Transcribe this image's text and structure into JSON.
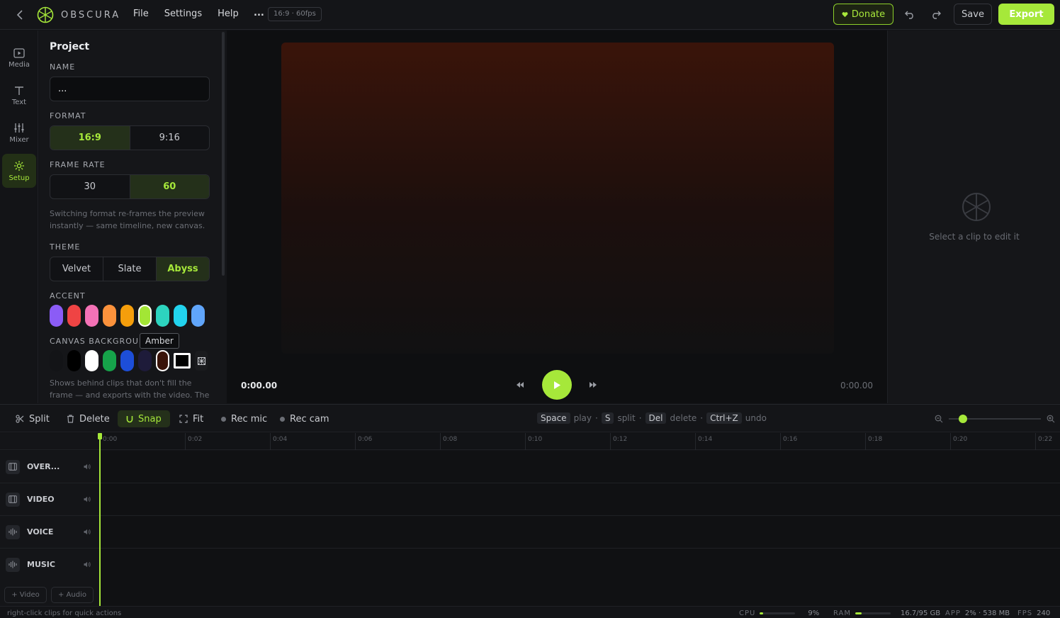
{
  "topbar": {
    "brand": "OBSCURA",
    "menu": [
      "File",
      "Settings",
      "Help"
    ],
    "project_dots": "...",
    "format_chip": "16:9 · 60fps",
    "donate_label": "Donate",
    "save_label": "Save",
    "export_label": "Export"
  },
  "rail": {
    "items": [
      {
        "label": "Media",
        "icon": "media-icon",
        "active": false
      },
      {
        "label": "Text",
        "icon": "text-icon",
        "active": false
      },
      {
        "label": "Mixer",
        "icon": "mixer-icon",
        "active": false
      },
      {
        "label": "Setup",
        "icon": "gear-icon",
        "active": true
      }
    ]
  },
  "panel": {
    "title": "Project",
    "name_label": "NAME",
    "name_value": "...",
    "format_label": "FORMAT",
    "format_options": [
      "16:9",
      "9:16"
    ],
    "format_selected": "16:9",
    "framerate_label": "FRAME RATE",
    "framerate_options": [
      "30",
      "60"
    ],
    "framerate_selected": "60",
    "format_hint": "Switching format re-frames the preview instantly — same timeline, new canvas.",
    "theme_label": "THEME",
    "theme_options": [
      "Velvet",
      "Slate",
      "Abyss"
    ],
    "theme_selected": "Abyss",
    "accent_label": "ACCENT",
    "accent_colors": [
      "#8b5cf6",
      "#ef4444",
      "#f472b6",
      "#fb923c",
      "#f59e0b",
      "#a3e635",
      "#2dd4bf",
      "#22d3ee",
      "#60a5fa"
    ],
    "accent_selected_index": 5,
    "tooltip": "Amber",
    "canvas_bg_label": "CANVAS BACKGROUND",
    "canvas_bg_colors": [
      "#131417",
      "#000000",
      "#ffffff",
      "#16a34a",
      "#1d4ed8",
      "#1e1b3a",
      "#3a140a"
    ],
    "canvas_bg_hint": "Shows behind clips that don't fill the frame — and exports with the video. The ▩ button"
  },
  "preview": {
    "time_current": "0:00.00",
    "time_total": "0:00.00"
  },
  "inspector": {
    "empty_text": "Select a clip to edit it"
  },
  "toolbar": {
    "split": "Split",
    "delete": "Delete",
    "snap": "Snap",
    "fit": "Fit",
    "rec_mic": "Rec mic",
    "rec_cam": "Rec cam",
    "shortcuts": [
      {
        "key": "Space",
        "action": "play"
      },
      {
        "key": "S",
        "action": "split"
      },
      {
        "key": "Del",
        "action": "delete"
      },
      {
        "key": "Ctrl+Z",
        "action": "undo"
      }
    ],
    "zoom_level": 0.15
  },
  "ruler": {
    "ticks": [
      "0:00",
      "0:02",
      "0:04",
      "0:06",
      "0:08",
      "0:10",
      "0:12",
      "0:14",
      "0:16",
      "0:18",
      "0:20",
      "0:22"
    ]
  },
  "tracks": [
    {
      "name": "OVER...",
      "icon": "film-icon"
    },
    {
      "name": "VIDEO",
      "icon": "film-icon"
    },
    {
      "name": "VOICE",
      "icon": "waveform-icon"
    },
    {
      "name": "MUSIC",
      "icon": "waveform-icon"
    }
  ],
  "add_buttons": {
    "video": "+ Video",
    "audio": "+ Audio"
  },
  "status": {
    "hint": "right-click clips for quick actions",
    "cpu_label": "CPU",
    "cpu_value": "9%",
    "cpu_fraction": 0.09,
    "ram_label": "RAM",
    "ram_value": "16.7/95 GB",
    "ram_fraction": 0.18,
    "app_label": "APP",
    "app_value": "2% · 538 MB",
    "fps_label": "FPS",
    "fps_value": "240"
  },
  "colors": {
    "accent": "#a6e83a"
  }
}
